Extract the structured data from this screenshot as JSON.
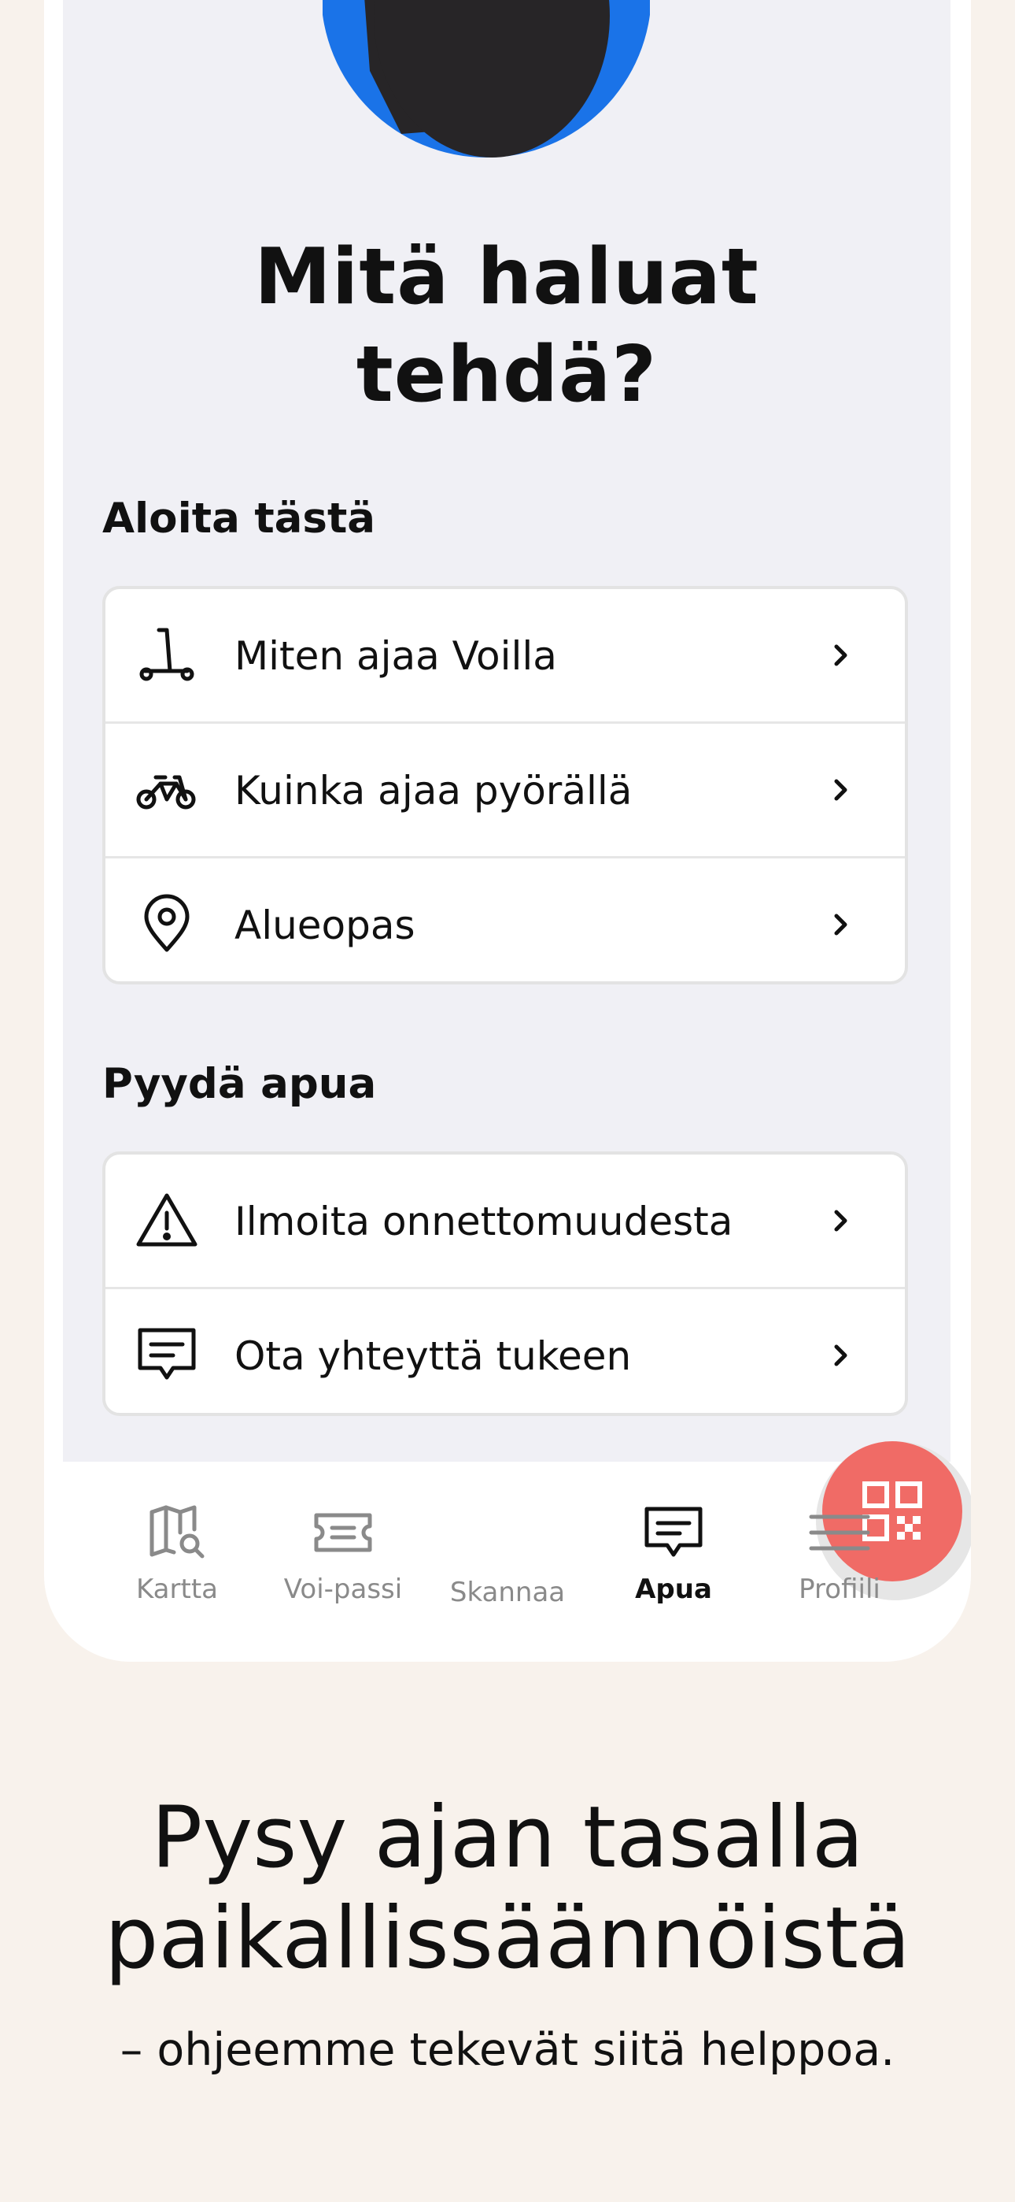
{
  "screen": {
    "title_line1": "Mitä haluat",
    "title_line2": "tehdä?",
    "section_start": {
      "title": "Aloita tästä",
      "items": [
        {
          "label": "Miten ajaa Voilla",
          "icon": "scooter-icon"
        },
        {
          "label": "Kuinka ajaa pyörällä",
          "icon": "bicycle-icon"
        },
        {
          "label": "Alueopas",
          "icon": "location-pin-icon"
        }
      ]
    },
    "section_help": {
      "title": "Pyydä apua",
      "items": [
        {
          "label": "Ilmoita onnettomuudesta",
          "icon": "warning-icon"
        },
        {
          "label": "Ota yhteyttä tukeen",
          "icon": "chat-icon"
        }
      ]
    }
  },
  "tabbar": {
    "tabs": [
      {
        "label": "Kartta",
        "icon": "map-search-icon"
      },
      {
        "label": "Voi-passi",
        "icon": "ticket-icon"
      },
      {
        "label": "Skannaa",
        "icon": "qr-code-icon"
      },
      {
        "label": "Apua",
        "icon": "chat-icon",
        "active": true
      },
      {
        "label": "Profiili",
        "icon": "menu-icon"
      }
    ]
  },
  "promo": {
    "headline_line1": "Pysy ajan tasalla",
    "headline_line2": "paikallissäännöistä",
    "subtitle": "– ohjeemme tekevät siitä helppoa."
  },
  "colors": {
    "background": "#f8f2ec",
    "screen": "#f0f0f5",
    "scan_button": "#f06b66",
    "avatar_blue": "#1a73e8",
    "avatar_dark": "#272527"
  }
}
